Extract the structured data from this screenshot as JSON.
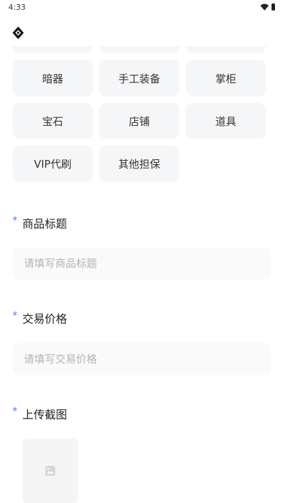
{
  "status_bar": {
    "time": "4:33"
  },
  "categories": {
    "partial_row": [
      "",
      "",
      ""
    ],
    "rows": [
      [
        "暗器",
        "手工装备",
        "掌柜"
      ],
      [
        "宝石",
        "店铺",
        "道具"
      ],
      [
        "VIP代刷",
        "其他担保"
      ]
    ]
  },
  "form": {
    "title_field": {
      "label": "商品标题",
      "placeholder": "请填写商品标题",
      "value": ""
    },
    "price_field": {
      "label": "交易价格",
      "placeholder": "请填写交易价格",
      "value": ""
    },
    "screenshot_field": {
      "label": "上传截图"
    },
    "required_mark": "*"
  },
  "colors": {
    "accent": "#3b7cff",
    "chip_bg": "#f5f6f8",
    "placeholder": "#b3b3b3"
  },
  "icons": {
    "logo": "diamond-logo-icon",
    "upload": "image-icon",
    "wifi": "wifi-icon",
    "battery": "battery-icon"
  }
}
